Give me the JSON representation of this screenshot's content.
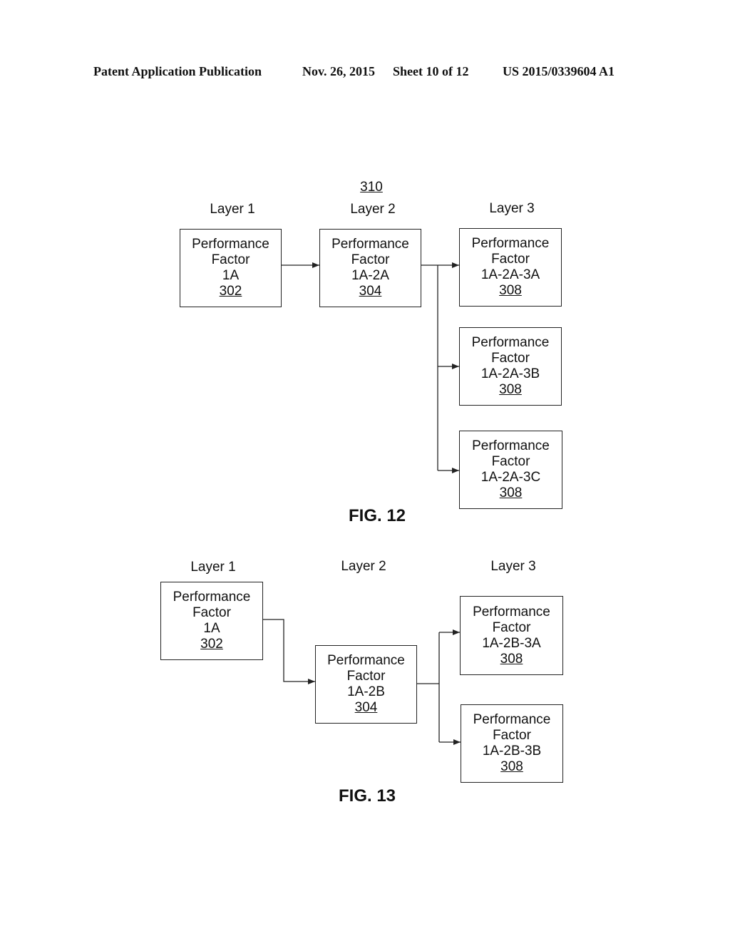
{
  "header": {
    "left": "Patent Application Publication",
    "date": "Nov. 26, 2015",
    "sheet": "Sheet 10 of 12",
    "number": "US 2015/0339604 A1"
  },
  "fig12": {
    "ref": "310",
    "layers": [
      "Layer 1",
      "Layer 2",
      "Layer 3"
    ],
    "caption": "FIG. 12",
    "boxes": [
      {
        "line1": "Performance",
        "line2": "Factor",
        "id": "1A",
        "ref": "302"
      },
      {
        "line1": "Performance",
        "line2": "Factor",
        "id": "1A-2A",
        "ref": "304"
      },
      {
        "line1": "Performance",
        "line2": "Factor",
        "id": "1A-2A-3A",
        "ref": "308"
      },
      {
        "line1": "Performance",
        "line2": "Factor",
        "id": "1A-2A-3B",
        "ref": "308"
      },
      {
        "line1": "Performance",
        "line2": "Factor",
        "id": "1A-2A-3C",
        "ref": "308"
      }
    ]
  },
  "fig13": {
    "layers": [
      "Layer 1",
      "Layer 2",
      "Layer 3"
    ],
    "caption": "FIG. 13",
    "boxes": [
      {
        "line1": "Performance",
        "line2": "Factor",
        "id": "1A",
        "ref": "302"
      },
      {
        "line1": "Performance",
        "line2": "Factor",
        "id": "1A-2B",
        "ref": "304"
      },
      {
        "line1": "Performance",
        "line2": "Factor",
        "id": "1A-2B-3A",
        "ref": "308"
      },
      {
        "line1": "Performance",
        "line2": "Factor",
        "id": "1A-2B-3B",
        "ref": "308"
      }
    ]
  }
}
